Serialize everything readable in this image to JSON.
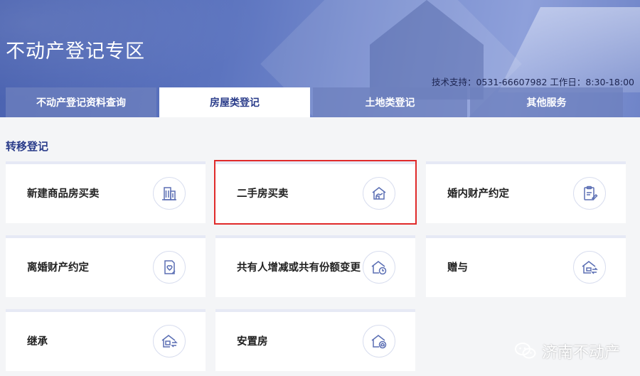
{
  "banner": {
    "title": "不动产登记专区",
    "support": "技术支持：0531-66607982 工作日：8:30-18:00"
  },
  "tabs": [
    {
      "label": "不动产登记资料查询",
      "active": false
    },
    {
      "label": "房屋类登记",
      "active": true
    },
    {
      "label": "土地类登记",
      "active": false
    },
    {
      "label": "其他服务",
      "active": false
    }
  ],
  "section": {
    "title": "转移登记"
  },
  "cards": [
    {
      "label": "新建商品房买卖",
      "icon": "building-icon"
    },
    {
      "label": "二手房买卖",
      "icon": "house-hand-icon",
      "selected": true
    },
    {
      "label": "婚内财产约定",
      "icon": "clipboard-sign-icon"
    },
    {
      "label": "离婚财产约定",
      "icon": "document-heart-icon"
    },
    {
      "label": "共有人增减或共有份额变更",
      "icon": "house-clock-icon"
    },
    {
      "label": "赠与",
      "icon": "house-transfer-icon"
    },
    {
      "label": "继承",
      "icon": "house-inherit-icon"
    },
    {
      "label": "安置房",
      "icon": "house-home-icon"
    }
  ],
  "watermark": {
    "text": "济南不动产",
    "icon": "wechat-icon"
  },
  "colors": {
    "accent": "#2a3c8a",
    "highlight": "#e02a2a",
    "banner": "#5c74bf"
  }
}
